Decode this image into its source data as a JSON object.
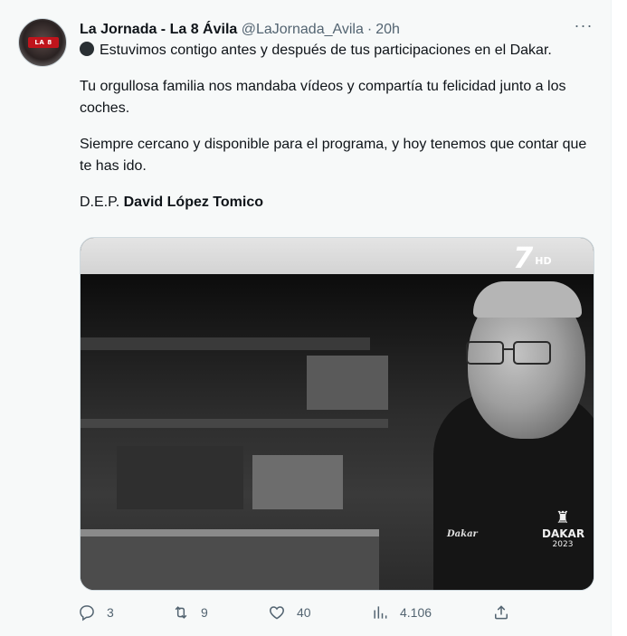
{
  "tweet": {
    "author": {
      "display_name": "La Jornada - La 8 Ávila",
      "handle": "@LaJornada_Avila",
      "separator": "·",
      "time": "20h"
    },
    "more_icon": "ellipsis-icon",
    "paragraphs": [
      "Estuvimos contigo antes y después de tus participaciones en el Dakar.",
      "Tu orgullosa familia nos mandaba vídeos y compartía tu felicidad junto a los coches.",
      "Siempre cercano y disponible para el programa, y hoy tenemos que contar que te has ido."
    ],
    "rip_prefix": "D.E.P.",
    "rip_name": "David López Tomico",
    "media": {
      "channel_number": "7",
      "channel_hd": "HD",
      "dakar_word": "DAKAR",
      "dakar_year": "2023",
      "hoodie_text": "Dakar"
    },
    "actions": {
      "replies": "3",
      "retweets": "9",
      "likes": "40",
      "views": "4.106"
    }
  }
}
